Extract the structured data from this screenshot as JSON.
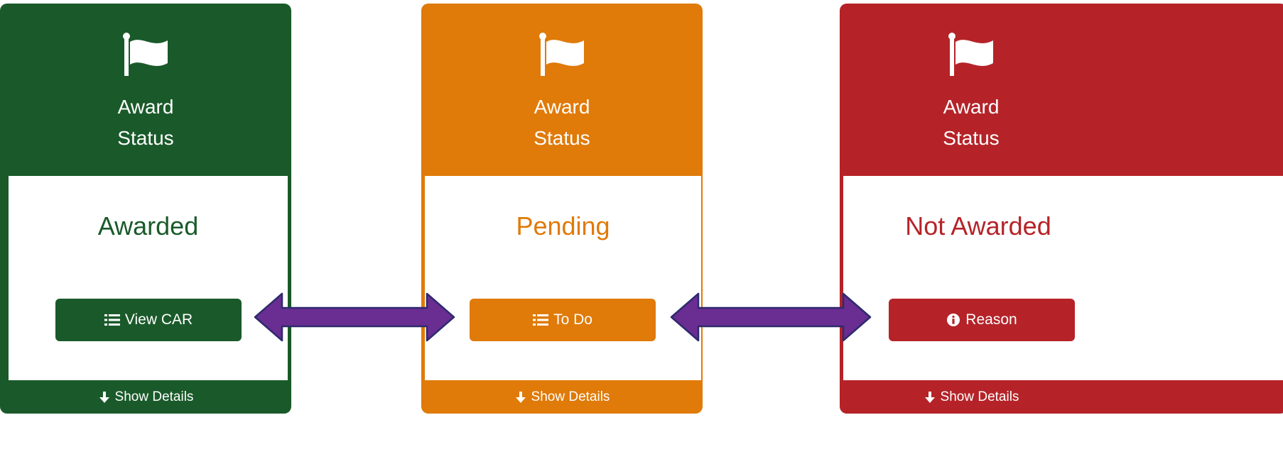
{
  "cards": [
    {
      "header_line1": "Award",
      "header_line2": "Status",
      "status": "Awarded",
      "button_label": "View CAR",
      "button_icon": "list-icon",
      "footer_label": "Show Details",
      "color": "#1a5a2a"
    },
    {
      "header_line1": "Award",
      "header_line2": "Status",
      "status": "Pending",
      "button_label": "To Do",
      "button_icon": "list-icon",
      "footer_label": "Show Details",
      "color": "#e07a08"
    },
    {
      "header_line1": "Award",
      "header_line2": "Status",
      "status": "Not Awarded",
      "button_label": "Reason",
      "button_icon": "info-circle-icon",
      "footer_label": "Show Details",
      "color": "#b52328"
    }
  ],
  "arrow_color": "#6a2d91"
}
